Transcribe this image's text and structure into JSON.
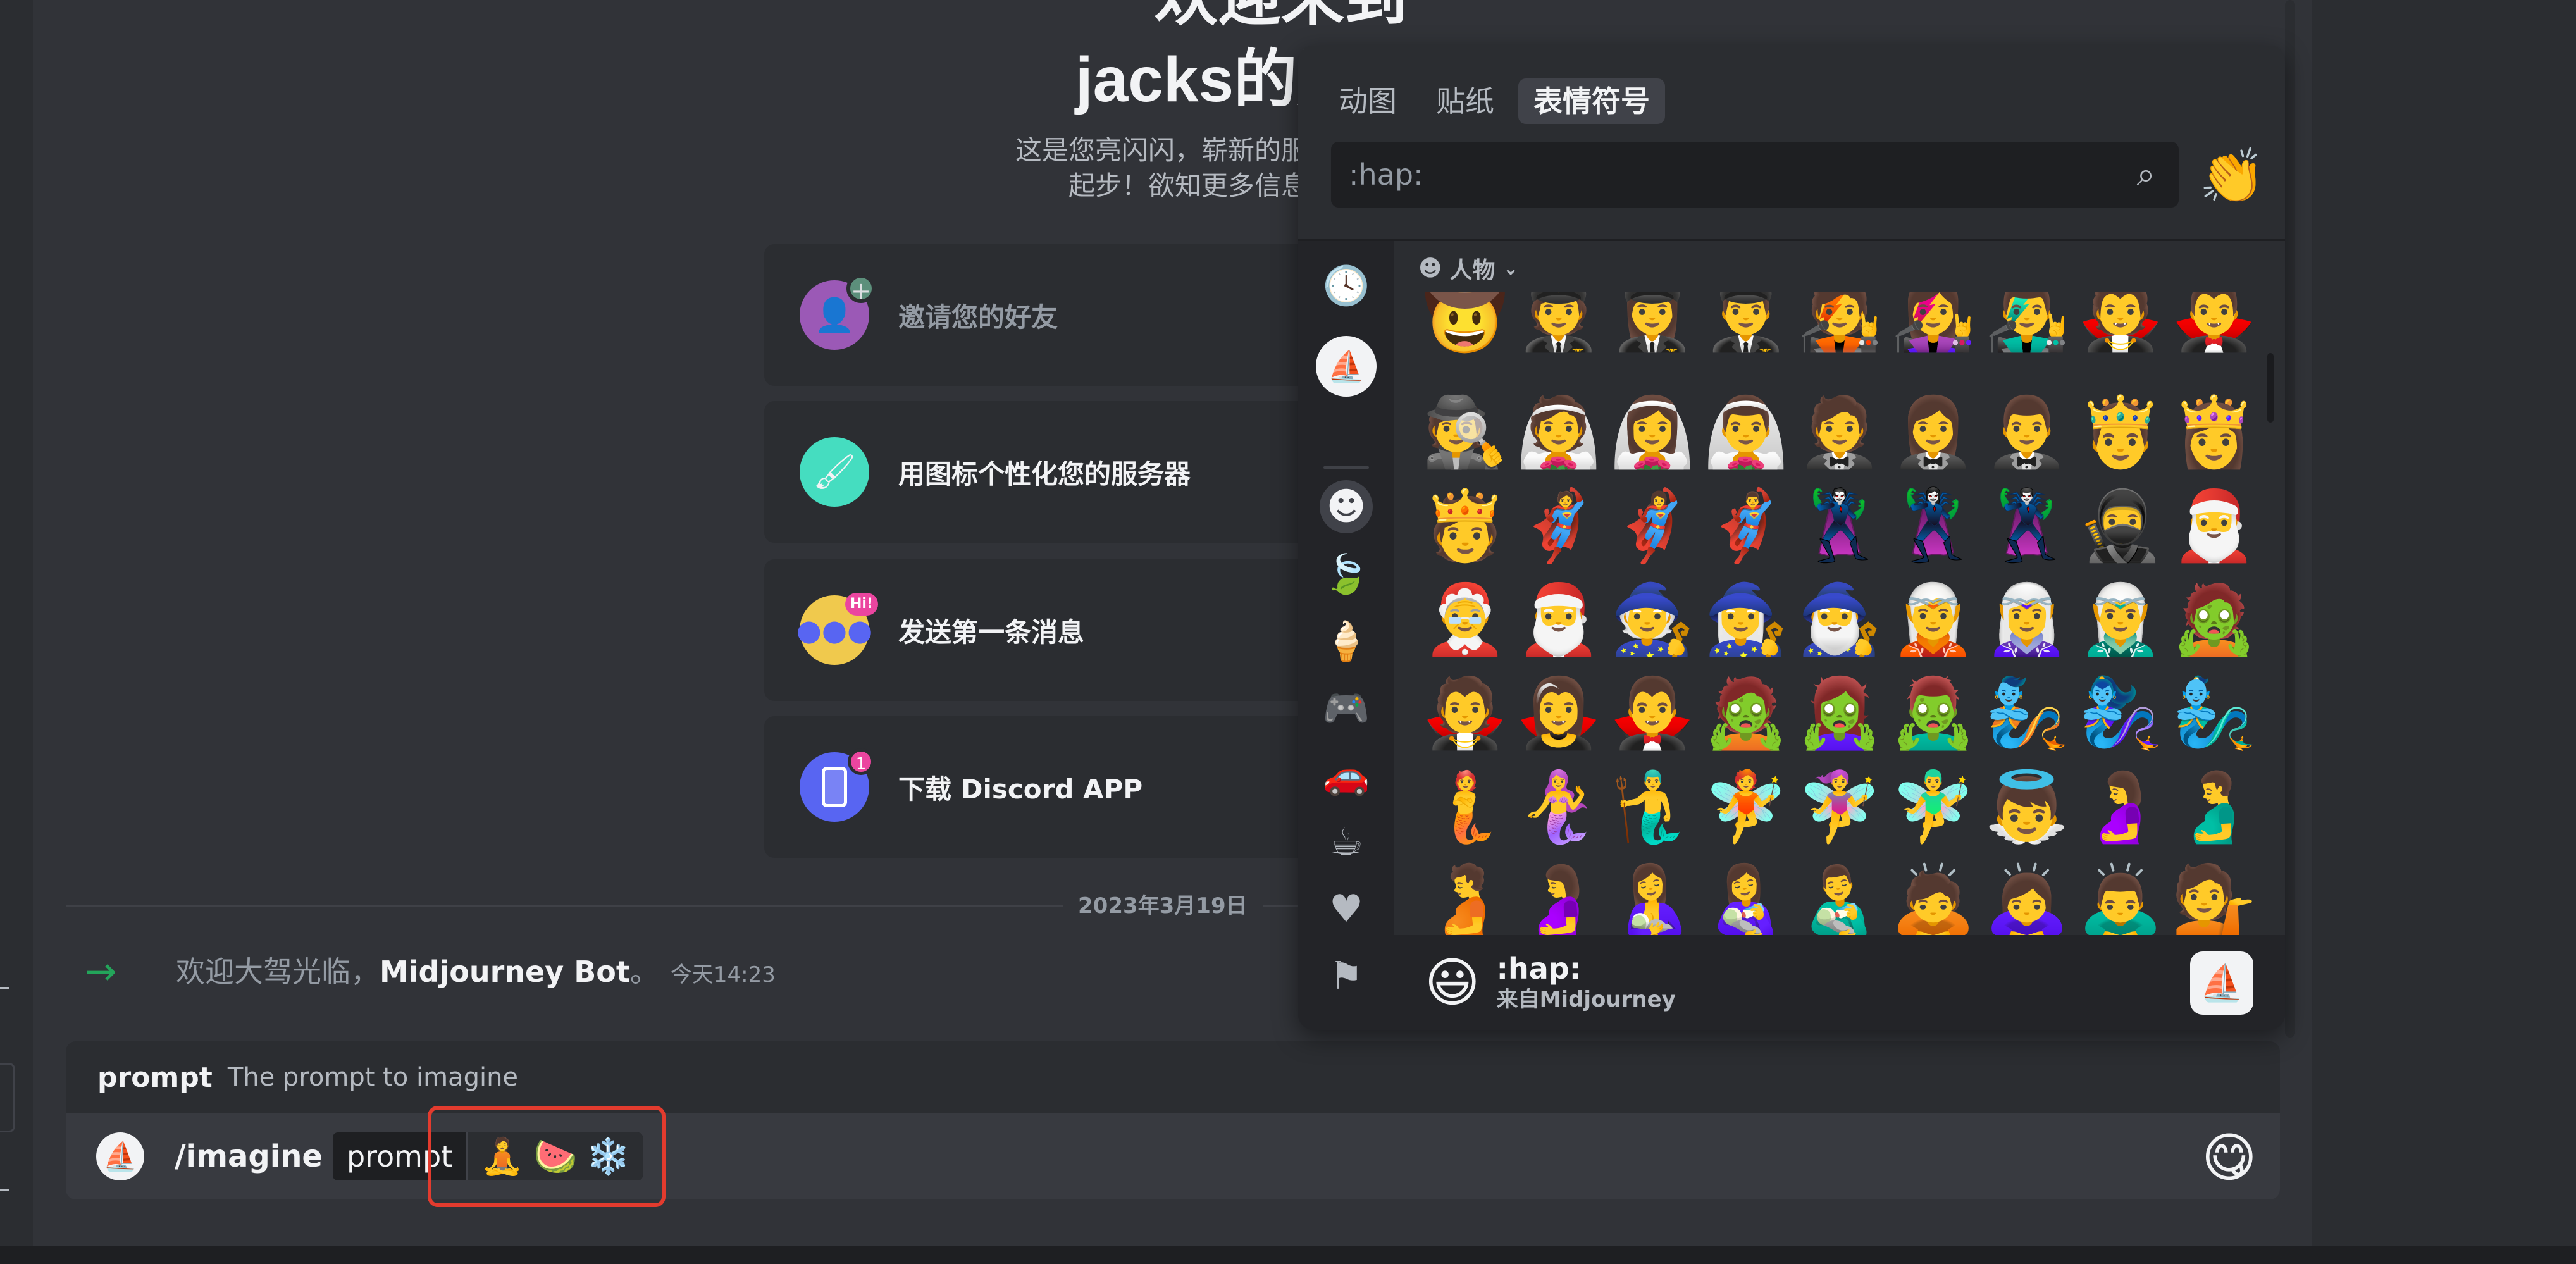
{
  "welcome": {
    "title_line1": "欢迎来到",
    "title_line2": "jacks的服务器",
    "subtitle_line1": "这是您亮闪闪，崭新的服务器。请在这里查看",
    "subtitle_line2": "起步！欲知更多信息，请参阅我们的"
  },
  "cards": [
    {
      "label": "邀请您的好友",
      "icon": "invite-friends-icon",
      "color": "#9b59b6",
      "done": true
    },
    {
      "label": "用图标个性化您的服务器",
      "icon": "paint-brush-icon",
      "color": "#45ddc0",
      "done": false
    },
    {
      "label": "发送第一条消息",
      "icon": "chat-bubble-icon",
      "color": "#f0c94d",
      "badge": "Hi!",
      "done": false
    },
    {
      "label": "下载 Discord APP",
      "icon": "phone-icon",
      "color": "#5865f2",
      "badge": "1",
      "done": false
    }
  ],
  "divider": {
    "date": "2023年3月19日"
  },
  "join_message": {
    "prefix": "欢迎大驾光临，",
    "bot_name": "Midjourney Bot",
    "suffix": "。",
    "time": "今天14:23",
    "accent": "#23a55a"
  },
  "command": {
    "option_name": "prompt",
    "option_desc": "The prompt to imagine",
    "name": "/imagine",
    "param_label": "prompt",
    "param_emojis": [
      "🧘",
      "🍉",
      "❄️"
    ],
    "emoji_button": "😋",
    "highlight_color": "#e33b2e"
  },
  "picker": {
    "tabs": [
      {
        "label": "动图",
        "active": false
      },
      {
        "label": "贴纸",
        "active": false
      },
      {
        "label": "表情符号",
        "active": true
      }
    ],
    "search_value": ":hap:",
    "search_icon": "search-icon",
    "clap_emoji": "👏",
    "categories": [
      {
        "name": "recent-icon",
        "glyph": "🕓"
      },
      {
        "name": "server-icon",
        "glyph": "⛵"
      },
      {
        "name": "people-icon",
        "glyph": "☻"
      },
      {
        "name": "nature-icon",
        "glyph": "🍃"
      },
      {
        "name": "food-icon",
        "glyph": "🍦"
      },
      {
        "name": "activities-icon",
        "glyph": "🎮"
      },
      {
        "name": "travel-icon",
        "glyph": "🚗"
      },
      {
        "name": "objects-icon",
        "glyph": "☕"
      },
      {
        "name": "symbols-icon",
        "glyph": "♥"
      },
      {
        "name": "flags-icon",
        "glyph": "⚑"
      }
    ],
    "section_title": "人物",
    "grid_partial": [
      "🤠",
      "🧑‍✈️",
      "👩‍✈️",
      "👨‍✈️",
      "🧑‍🎤",
      "👩‍🎤",
      "👨‍🎤",
      "🧛",
      "🧛‍♂️"
    ],
    "grid": [
      "🕵️",
      "👰",
      "👰‍♀️",
      "👰‍♂️",
      "🤵",
      "🤵‍♀️",
      "🤵‍♂️",
      "🤴",
      "👸",
      "🫅",
      "🦸",
      "🦸‍♀️",
      "🦸‍♂️",
      "🦹",
      "🦹‍♀️",
      "🦹‍♂️",
      "🥷",
      "🎅",
      "🤶",
      "🎅",
      "🧙",
      "🧙‍♀️",
      "🧙‍♂️",
      "🧝",
      "🧝‍♀️",
      "🧝‍♂️",
      "🧟",
      "🧛",
      "🧛‍♀️",
      "🧛‍♂️",
      "🧟",
      "🧟‍♀️",
      "🧟‍♂️",
      "🧞",
      "🧞‍♀️",
      "🧞‍♂️",
      "🧜",
      "🧜‍♀️",
      "🧜‍♂️",
      "🧚",
      "🧚‍♀️",
      "🧚‍♂️",
      "👼",
      "🤰",
      "🫃",
      "🫄",
      "🤰",
      "🤱",
      "👩‍🍼",
      "👨‍🍼",
      "🙇",
      "🙇‍♀️",
      "🙇‍♂️",
      "💁"
    ],
    "footer": {
      "emoji": "😃",
      "name": ":hap:",
      "source": "来自Midjourney",
      "server_glyph": "⛵"
    }
  }
}
